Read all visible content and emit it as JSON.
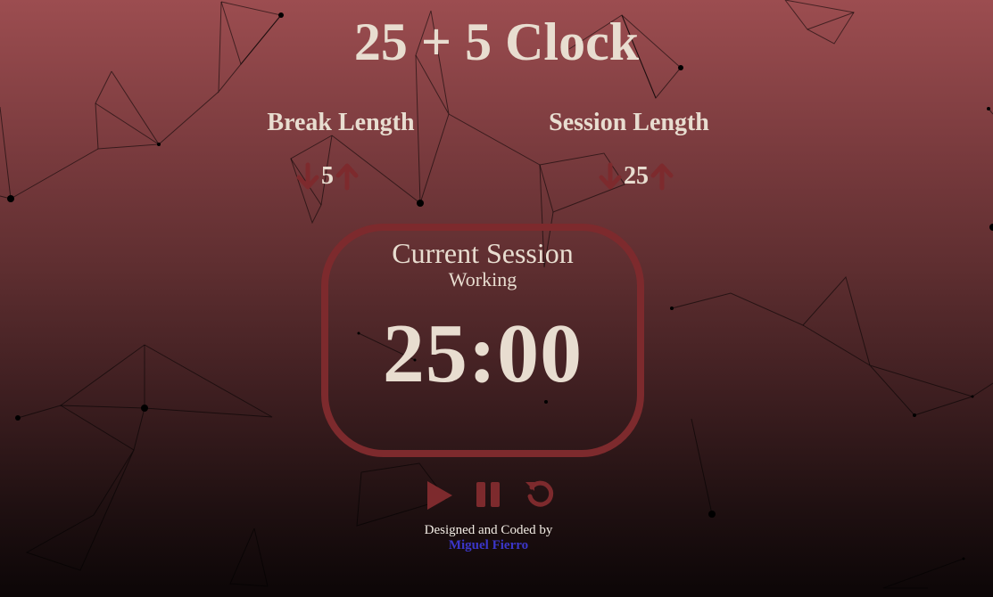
{
  "app": {
    "title": "25 + 5 Clock"
  },
  "break": {
    "label": "Break Length",
    "value": "5",
    "decrement_icon": "arrow-down-icon",
    "increment_icon": "arrow-up-icon"
  },
  "session": {
    "label": "Session Length",
    "value": "25",
    "decrement_icon": "arrow-down-icon",
    "increment_icon": "arrow-up-icon"
  },
  "timer": {
    "label": "Current Session",
    "status": "Working",
    "time": "25:00"
  },
  "controls": {
    "play_icon": "play-icon",
    "pause_icon": "pause-icon",
    "reset_icon": "refresh-icon"
  },
  "footer": {
    "credit_text": "Designed and Coded by",
    "author": "Miguel Fierro"
  },
  "colors": {
    "accent": "#7d2a2d",
    "text": "#e8ddd0",
    "link": "#3b36c9"
  }
}
